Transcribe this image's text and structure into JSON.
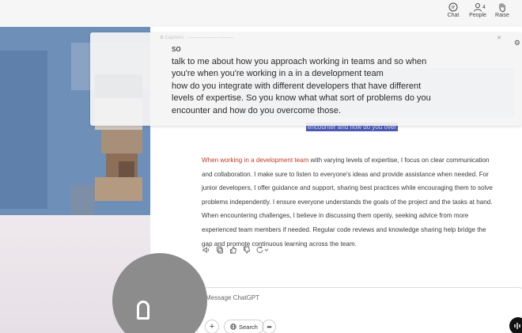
{
  "toolbar": {
    "chat_label": "Chat",
    "people_label": "People",
    "people_count": "4",
    "raise_label": "Raise"
  },
  "caption": {
    "header": "✿ Captions · ——— ——— ———",
    "lines": [
      "so",
      "talk to me about how you approach working in teams and so when",
      "you're when you're working in a in a development team",
      "how do you integrate with different developers that have different",
      "levels of expertise. So you know what what sort of problems do you",
      "encounter and how do you overcome those."
    ]
  },
  "chat": {
    "selected_text": "encounter and how do you over",
    "answer_lead": "When working in a development team",
    "answer_lines": [
      " with varying levels of expertise, I focus on clear communication",
      "and collaboration. I make sure to listen to everyone's ideas and provide assistance when needed. For",
      "junior developers, I offer guidance and support, sharing best practices while encouraging them to solve",
      "problems independently. I ensure everyone understands the goals of the project and the tasks at hand.",
      "When encountering challenges, I believe in discussing them openly, seeking advice from more",
      "experienced team members if needed. Regular code reviews and knowledge sharing help bridge the",
      "gap and promote continuous learning across the team."
    ],
    "composer_placeholder": "Message ChatGPT",
    "search_label": "Search"
  },
  "colors": {
    "accent_red": "#c0392b",
    "selection": "#4d5bb3"
  }
}
